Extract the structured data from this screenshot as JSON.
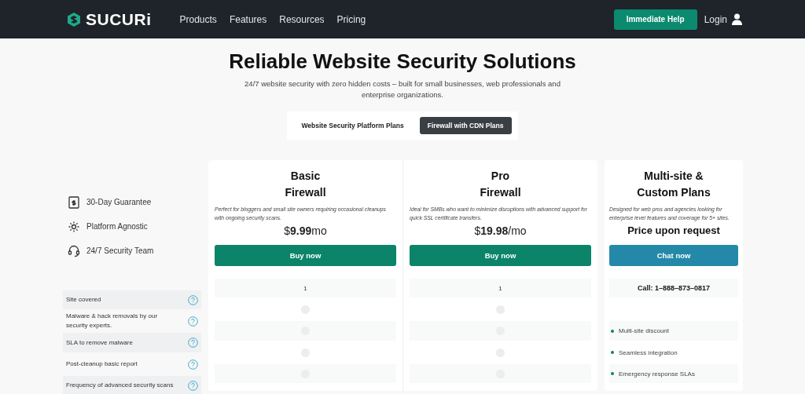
{
  "nav": {
    "logo": "SUCURi",
    "links": [
      "Products",
      "Features",
      "Resources",
      "Pricing"
    ],
    "help_button": "Immediate Help",
    "login": "Login"
  },
  "hero": {
    "title": "Reliable Website Security Solutions",
    "subtitle": "24/7 website security with zero hidden costs – built for small businesses, web professionals and enterprise organizations."
  },
  "tabs": [
    {
      "label": "Website Security Platform Plans",
      "selected": false
    },
    {
      "label": "Firewall with CDN Plans",
      "selected": true
    }
  ],
  "guarantees": [
    {
      "kind": "guarantee",
      "label": "30-Day Guarantee"
    },
    {
      "kind": "platform",
      "label": "Platform Agnostic"
    },
    {
      "kind": "support",
      "label": "24/7 Security Team"
    }
  ],
  "features": [
    "Site covered",
    "Malware & hack removals by our security experts.",
    "SLA to remove malware",
    "Post-cleanup basic report",
    "Frequency of advanced security scans"
  ],
  "plans": [
    {
      "name_lines": [
        "Basic",
        "Firewall"
      ],
      "description": "Perfect for bloggers and small site owners requiring occasional cleanups with ongoing security scans.",
      "price": {
        "kind": "amount",
        "currency": "$",
        "amount": "9.99",
        "period": "mo"
      },
      "button": {
        "kind": "buy",
        "label": "Buy now"
      },
      "cells": [
        {
          "kind": "text",
          "text": "1"
        },
        {
          "kind": "dot"
        },
        {
          "kind": "dot"
        },
        {
          "kind": "dot"
        },
        {
          "kind": "dot"
        }
      ]
    },
    {
      "name_lines": [
        "Pro",
        "Firewall"
      ],
      "description": "Ideal for SMBs who want to minimize disruptions with advanced support for quick SSL certificate transfers.",
      "price": {
        "kind": "amount",
        "currency": "$",
        "amount": "19.98",
        "period": "/mo"
      },
      "button": {
        "kind": "buy",
        "label": "Buy now"
      },
      "cells": [
        {
          "kind": "text",
          "text": "1"
        },
        {
          "kind": "dot"
        },
        {
          "kind": "dot"
        },
        {
          "kind": "dot"
        },
        {
          "kind": "dot"
        }
      ]
    },
    {
      "name_lines": [
        "Multi-site &",
        "Custom Plans"
      ],
      "description": "Designed for web pros and agencies looking for enterprise level features and coverage for 5+ sites.",
      "price": {
        "kind": "request",
        "text": "Price upon request"
      },
      "button": {
        "kind": "chat",
        "label": "Chat now"
      },
      "cells": [
        {
          "kind": "phone",
          "text": "Call: 1–888–873–0817"
        },
        {
          "kind": "empty"
        },
        {
          "kind": "bullet",
          "text": "Multi-site discount"
        },
        {
          "kind": "bullet",
          "text": "Seamless integration"
        },
        {
          "kind": "bullet",
          "text": "Emergency response SLAs"
        }
      ]
    }
  ]
}
